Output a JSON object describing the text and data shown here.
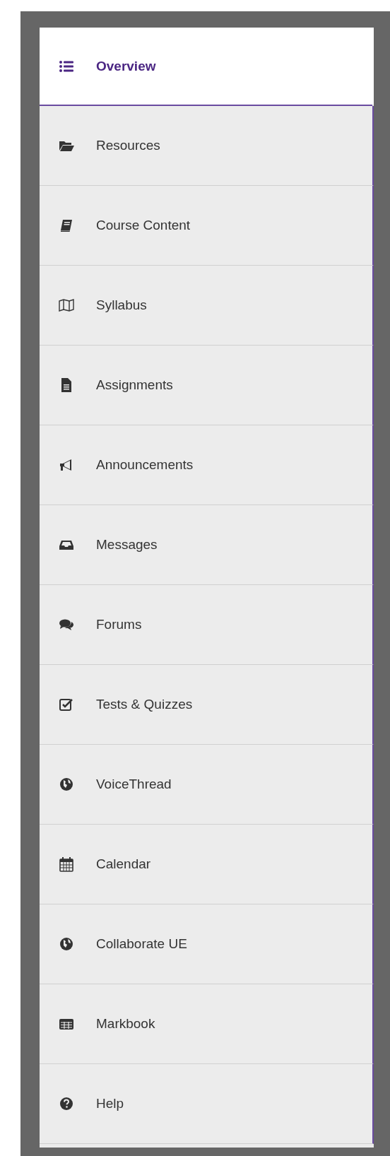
{
  "menu": [
    {
      "label": "Overview",
      "selected": true
    },
    {
      "label": "Resources",
      "selected": false
    },
    {
      "label": "Course Content",
      "selected": false
    },
    {
      "label": "Syllabus",
      "selected": false
    },
    {
      "label": "Assignments",
      "selected": false
    },
    {
      "label": "Announcements",
      "selected": false
    },
    {
      "label": "Messages",
      "selected": false
    },
    {
      "label": "Forums",
      "selected": false
    },
    {
      "label": "Tests & Quizzes",
      "selected": false
    },
    {
      "label": "VoiceThread",
      "selected": false
    },
    {
      "label": "Calendar",
      "selected": false
    },
    {
      "label": "Collaborate UE",
      "selected": false
    },
    {
      "label": "Markbook",
      "selected": false
    },
    {
      "label": "Help",
      "selected": false
    }
  ]
}
